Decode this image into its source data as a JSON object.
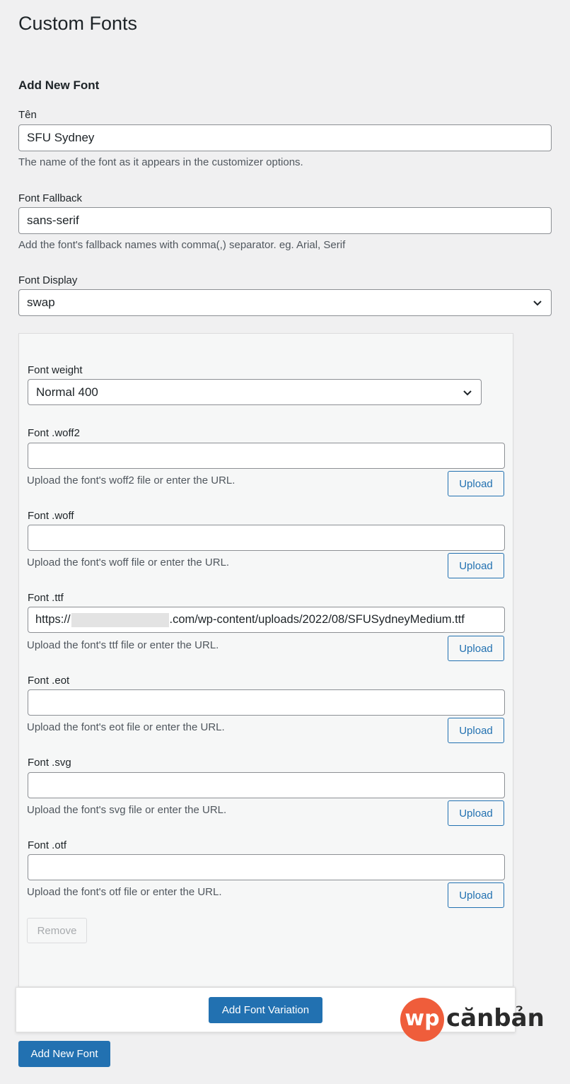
{
  "page": {
    "title": "Custom Fonts",
    "section_heading": "Add New Font"
  },
  "colors": {
    "primary": "#2271b1",
    "background": "#f0f0f1",
    "watermark_accent": "#ef5d3b"
  },
  "name_field": {
    "label": "Tên",
    "value": "SFU Sydney",
    "description": "The name of the font as it appears in the customizer options."
  },
  "fallback_field": {
    "label": "Font Fallback",
    "value": "sans-serif",
    "description": "Add the font's fallback names with comma(,) separator. eg. Arial, Serif"
  },
  "display_field": {
    "label": "Font Display",
    "value": "swap"
  },
  "variation": {
    "weight": {
      "label": "Font weight",
      "value": "Normal 400"
    },
    "files": [
      {
        "label": "Font .woff2",
        "value": "",
        "description": "Upload the font's woff2 file or enter the URL.",
        "button": "Upload"
      },
      {
        "label": "Font .woff",
        "value": "",
        "description": "Upload the font's woff file or enter the URL.",
        "button": "Upload"
      },
      {
        "label": "Font .ttf",
        "value_prefix": "https://",
        "value_suffix": ".com/wp-content/uploads/2022/08/SFUSydneyMedium.ttf",
        "description": "Upload the font's ttf file or enter the URL.",
        "button": "Upload"
      },
      {
        "label": "Font .eot",
        "value": "",
        "description": "Upload the font's eot file or enter the URL.",
        "button": "Upload"
      },
      {
        "label": "Font .svg",
        "value": "",
        "description": "Upload the font's svg file or enter the URL.",
        "button": "Upload"
      },
      {
        "label": "Font .otf",
        "value": "",
        "description": "Upload the font's otf file or enter the URL.",
        "button": "Upload"
      }
    ],
    "remove_label": "Remove"
  },
  "footer": {
    "add_variation_label": "Add Font Variation"
  },
  "submit": {
    "add_new_font_label": "Add New Font"
  },
  "watermark": {
    "logo_text": "wp",
    "brand_text": "cănbản"
  }
}
